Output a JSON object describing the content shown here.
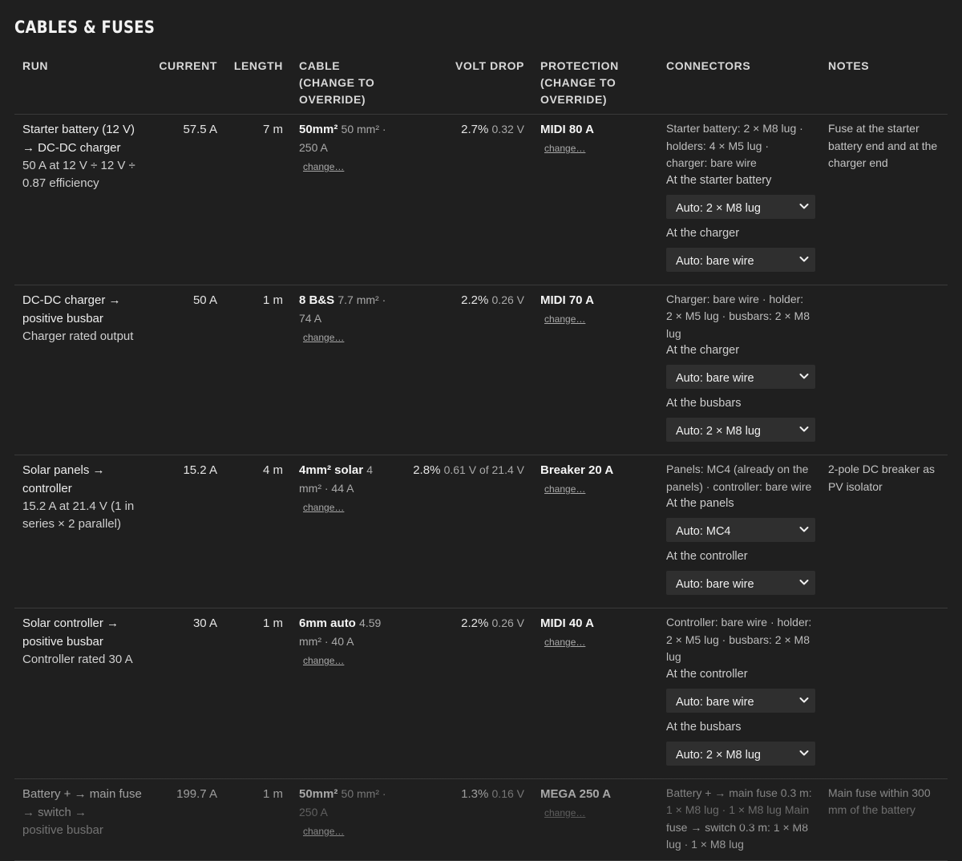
{
  "section": {
    "title": "CABLES & FUSES"
  },
  "table": {
    "headers": {
      "run": "RUN",
      "current": "CURRENT",
      "length": "LENGTH",
      "cable": "CABLE (CHANGE TO OVERRIDE)",
      "voltdrop": "VOLT DROP",
      "protection": "PROTECTION (CHANGE TO OVERRIDE)",
      "connectors": "CONNECTORS",
      "notes": "NOTES"
    },
    "change_label": "change…",
    "rows": [
      {
        "run": "Starter battery (12 V) → DC-DC charger",
        "sub": "50 A at 12 V ÷ 12 V ÷ 0.87 efficiency",
        "current": "57.5 A",
        "length": "7 m",
        "cable_main": "50mm²",
        "cable_detail": "50 mm² · 250 A",
        "vd_pct": "2.7%",
        "vd_val": "0.32 V",
        "protection": "MIDI 80 A",
        "conn_summary": "Starter battery: 2 × M8 lug · holders: 4 × M5 lug · charger: bare wire",
        "end1_label": "At the starter battery",
        "end1_value": "Auto: 2 × M8 lug",
        "end2_label": "At the charger",
        "end2_value": "Auto: bare wire",
        "notes": "Fuse at the starter battery end and at the charger end"
      },
      {
        "run": "DC-DC charger → positive busbar",
        "sub": "Charger rated output",
        "current": "50 A",
        "length": "1 m",
        "cable_main": "8 B&S",
        "cable_detail": "7.7 mm² · 74 A",
        "vd_pct": "2.2%",
        "vd_val": "0.26 V",
        "protection": "MIDI 70 A",
        "conn_summary": "Charger: bare wire · holder: 2 × M5 lug · busbars: 2 × M8 lug",
        "end1_label": "At the charger",
        "end1_value": "Auto: bare wire",
        "end2_label": "At the busbars",
        "end2_value": "Auto: 2 × M8 lug",
        "notes": ""
      },
      {
        "run": "Solar panels → controller",
        "sub": "15.2 A at 21.4 V (1 in series × 2 parallel)",
        "current": "15.2 A",
        "length": "4 m",
        "cable_main": "4mm² solar",
        "cable_detail": "4 mm² · 44 A",
        "vd_pct": "2.8%",
        "vd_val": "0.61 V of 21.4 V",
        "protection": "Breaker 20 A",
        "conn_summary": "Panels: MC4 (already on the panels) · controller: bare wire",
        "end1_label": "At the panels",
        "end1_value": "Auto: MC4",
        "end2_label": "At the controller",
        "end2_value": "Auto: bare wire",
        "notes": "2-pole DC breaker as PV isolator"
      },
      {
        "run": "Solar controller → positive busbar",
        "sub": "Controller rated 30 A",
        "current": "30 A",
        "length": "1 m",
        "cable_main": "6mm auto",
        "cable_detail": "4.59 mm² · 40 A",
        "vd_pct": "2.2%",
        "vd_val": "0.26 V",
        "protection": "MIDI 40 A",
        "conn_summary": "Controller: bare wire · holder: 2 × M5 lug · busbars: 2 × M8 lug",
        "end1_label": "At the controller",
        "end1_value": "Auto: bare wire",
        "end2_label": "At the busbars",
        "end2_value": "Auto: 2 × M8 lug",
        "notes": ""
      },
      {
        "run": "Battery + → main fuse → switch →",
        "sub": "positive busbar",
        "current": "199.7 A",
        "length": "1 m",
        "cable_main": "50mm²",
        "cable_detail": "50 mm² · 250 A",
        "vd_pct": "1.3%",
        "vd_val": "0.16 V",
        "protection": "MEGA 250 A",
        "conn_summary": "Battery + → main fuse 0.3 m: 1 × M8 lug · 1 × M8 lug Main fuse → switch 0.3 m: 1 × M8 lug · 1 × M8 lug",
        "notes": "Main fuse within 300 mm of the battery"
      }
    ]
  }
}
